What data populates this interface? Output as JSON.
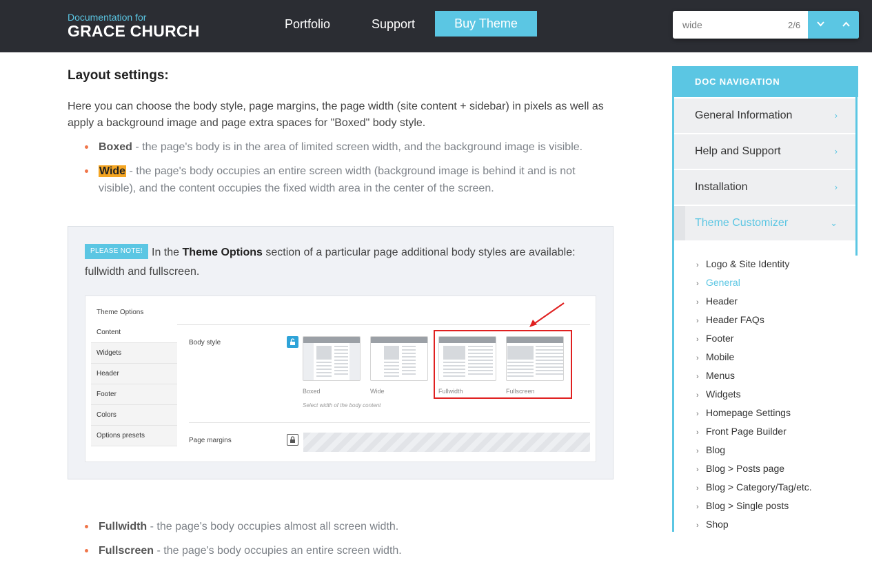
{
  "header": {
    "logo_small": "Documentation for",
    "logo_big": "GRACE CHURCH",
    "nav": [
      "Portfolio",
      "Support"
    ],
    "buy_label": "Buy Theme"
  },
  "find": {
    "value": "wide",
    "count": "2/6"
  },
  "main": {
    "heading": "Layout settings:",
    "intro": "Here you can choose the body style, page margins, the page width (site content + sidebar) in pixels as well as apply a background image and page extra spaces for \"Boxed\" body style.",
    "bullets_top": [
      {
        "term": "Boxed",
        "text": " - the page's body is in the area of limited screen width, and the background image is visible."
      },
      {
        "term": "Wide",
        "text": " - the page's body occupies an entire screen width (background image is behind it and is not visible), and the content occupies the fixed width area in the center of the screen."
      }
    ],
    "note": {
      "badge": "PLEASE NOTE!",
      "before": "In the ",
      "bold": "Theme Options",
      "after": " section of a particular page additional body styles are available: fullwidth and fullscreen."
    },
    "shot": {
      "title": "Theme Options",
      "menu": [
        "Content",
        "Widgets",
        "Header",
        "Footer",
        "Colors",
        "Options presets"
      ],
      "body_style_label": "Body style",
      "page_margins_label": "Page margins",
      "styles": [
        "Boxed",
        "Wide",
        "Fullwidth",
        "Fullscreen"
      ],
      "hint": "Select width of the body content"
    },
    "bullets_bottom": [
      {
        "term": "Fullwidth",
        "text": " - the page's body occupies almost all screen width."
      },
      {
        "term": "Fullscreen",
        "text": " - the page's body occupies an entire screen width."
      }
    ]
  },
  "sidebar": {
    "title": "DOC NAVIGATION",
    "items": [
      "General Information",
      "Help and Support",
      "Installation",
      "Theme Customizer"
    ],
    "subitems": [
      "Logo & Site Identity",
      "General",
      "Header",
      "Header FAQs",
      "Footer",
      "Mobile",
      "Menus",
      "Widgets",
      "Homepage Settings",
      "Front Page Builder",
      "Blog",
      "Blog > Posts page",
      "Blog > Category/Tag/etc.",
      "Blog > Single posts",
      "Shop"
    ]
  },
  "colors": {
    "accent": "#5bc6e3",
    "header_bg": "#2b2d33",
    "bullet": "#f0764a",
    "highlight": "#f5a623",
    "marker_red": "#e02020"
  }
}
